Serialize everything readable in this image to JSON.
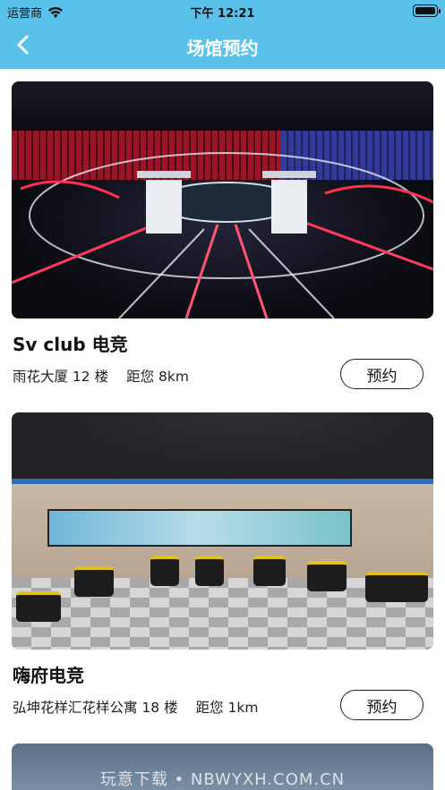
{
  "status_bar": {
    "carrier": "运营商",
    "time": "下午 12:21"
  },
  "nav": {
    "title": "场馆预约"
  },
  "venues": [
    {
      "name": "Sv club 电竞",
      "address": "雨花大厦 12 楼",
      "distance": "距您 8km",
      "button": "预约"
    },
    {
      "name": "嗨府电竞",
      "address": "弘坤花样汇花样公寓 18 楼",
      "distance": "距您 1km",
      "button": "预约"
    }
  ],
  "watermark": "玩意下载 • NBWYXH.COM.CN",
  "colors": {
    "accent": "#5ac1ea"
  }
}
